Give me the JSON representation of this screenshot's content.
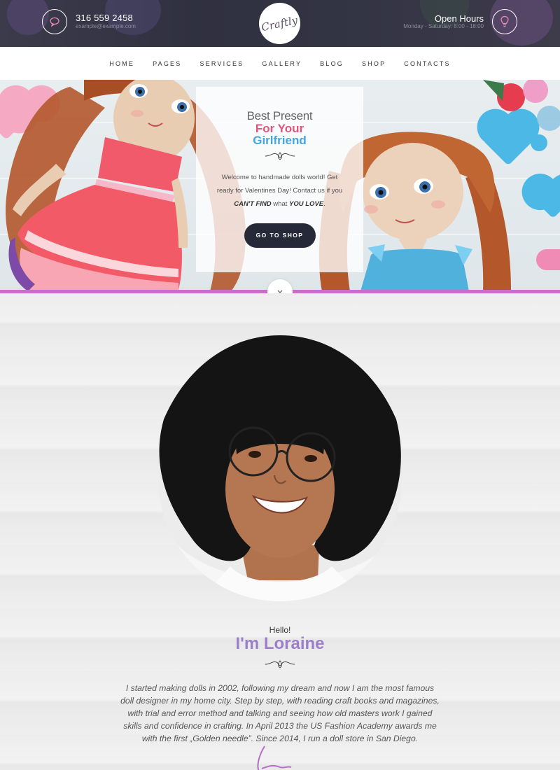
{
  "header": {
    "phone": "316 559 2458",
    "email": "example@example.com",
    "logo_text": "Craftly",
    "hours_title": "Open Hours",
    "hours_detail": "Monday - Saturday: 8:00 - 18:00"
  },
  "nav": {
    "items": [
      "HOME",
      "PAGES",
      "SERVICES",
      "GALLERY",
      "BLOG",
      "SHOP",
      "CONTACTS"
    ]
  },
  "hero": {
    "line1": "Best Present",
    "line2": "For Your",
    "line3": "Girlfriend",
    "text_a": "Welcome to handmade dolls world! Get ready for Valentines Day! Contact us if you ",
    "text_em1": "CAN'T FIND",
    "text_b": " what ",
    "text_em2": "YOU LOVE",
    "text_c": ".",
    "button": "GO TO SHOP"
  },
  "about": {
    "hello": "Hello!",
    "name": "I'm Loraine",
    "bio": "I started making dolls in 2002, following my dream and now I am the most famous doll designer in my home city. Step by step, with reading craft books and magazines, with trial and error method and talking and seeing how old masters work I gained skills and confidence in crafting. In April 2013 the US Fashion Academy awards me with the first „Golden needle”. Since 2014, I run a doll store in San Diego."
  },
  "colors": {
    "accent_purple": "#9b7fc9",
    "accent_pink": "#e2557d",
    "accent_blue": "#45a6dc",
    "dark": "#262a38",
    "stripe": "#c86fcc"
  },
  "icons": {
    "left_circle": "speech-bubble-icon",
    "right_circle": "lightbulb-icon",
    "down": "chevron-down-icon"
  }
}
